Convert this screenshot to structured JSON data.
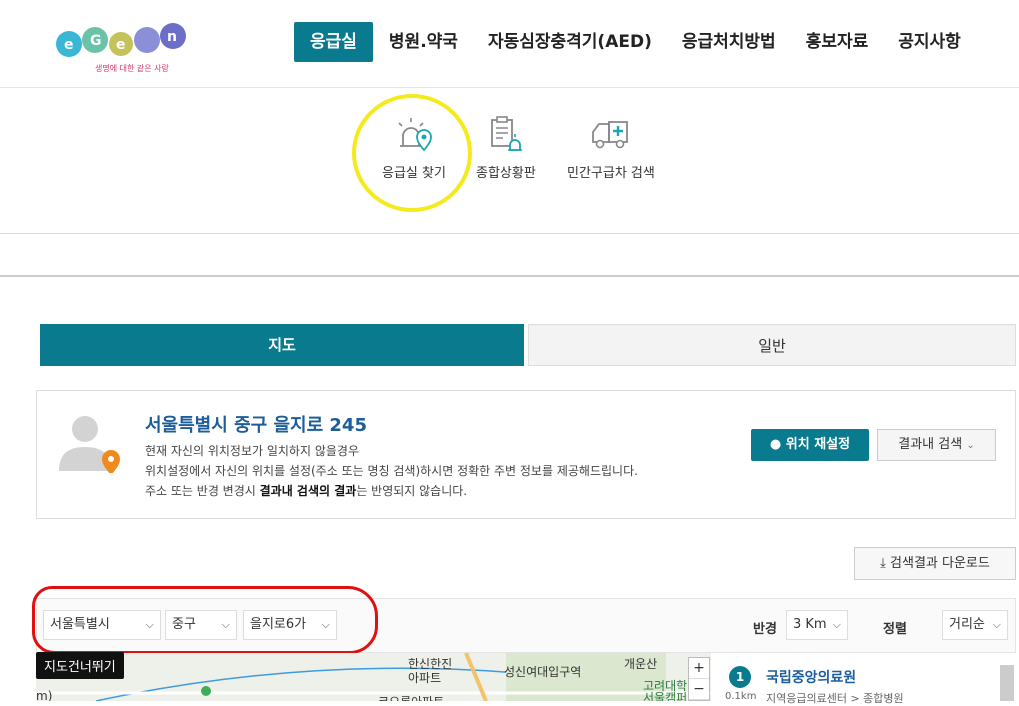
{
  "header": {
    "logo_tagline": "생명에 대한 같은 사랑",
    "nav": [
      {
        "label": "응급실",
        "active": true
      },
      {
        "label": "병원.약국"
      },
      {
        "label": "자동심장충격기(AED)"
      },
      {
        "label": "응급처치방법"
      },
      {
        "label": "홍보자료"
      },
      {
        "label": "공지사항"
      }
    ]
  },
  "sub_menu": {
    "items": [
      {
        "label": "응급실 찾기",
        "icon": "er-location-icon"
      },
      {
        "label": "종합상황판",
        "icon": "clipboard-siren-icon"
      },
      {
        "label": "민간구급차 검색",
        "icon": "ambulance-icon"
      }
    ]
  },
  "tabs": {
    "map": "지도",
    "general": "일반"
  },
  "location": {
    "address": "서울특별시 중구 을지로 245",
    "line1": "현재 자신의 위치정보가 일치하지 않을경우",
    "line2": "위치설정에서 자신의 위치를 설정(주소 또는 명칭 검색)하시면 정확한 주변 정보를 제공해드립니다.",
    "line3_pre": "주소 또는 반경 변경시 ",
    "line3_bold": "결과내 검색의 결과",
    "line3_post": "는 반영되지 않습니다.",
    "reset_button": "위치 재설정",
    "search_within_button": "결과내 검색"
  },
  "download_button": "검색결과 다운로드",
  "filters": {
    "city": "서울특별시",
    "district": "중구",
    "dong": "을지로6가",
    "radius_label": "반경",
    "radius_value": "3 Km",
    "sort_label": "정렬",
    "sort_value": "거리순"
  },
  "map": {
    "skip_button": "지도건너뛰기",
    "labels": {
      "l1": "한신한진",
      "l2": "아파트",
      "l3": "성신여대입구역",
      "l4": "개운산",
      "l5": "고려대학",
      "l6": "서울캠퍼",
      "l7": "코오롱아파트",
      "l8": "m)"
    },
    "zoom_in": "+",
    "zoom_out": "−"
  },
  "results": [
    {
      "num": "1",
      "name": "국립중앙의료원",
      "distance": "0.1km",
      "type": "지역응급의료센터 > 종합병원"
    }
  ],
  "colors": {
    "accent": "#0a7b8f",
    "link": "#1d5d9b",
    "annotation_yellow": "#f5ea1c",
    "annotation_red": "#e01010"
  }
}
